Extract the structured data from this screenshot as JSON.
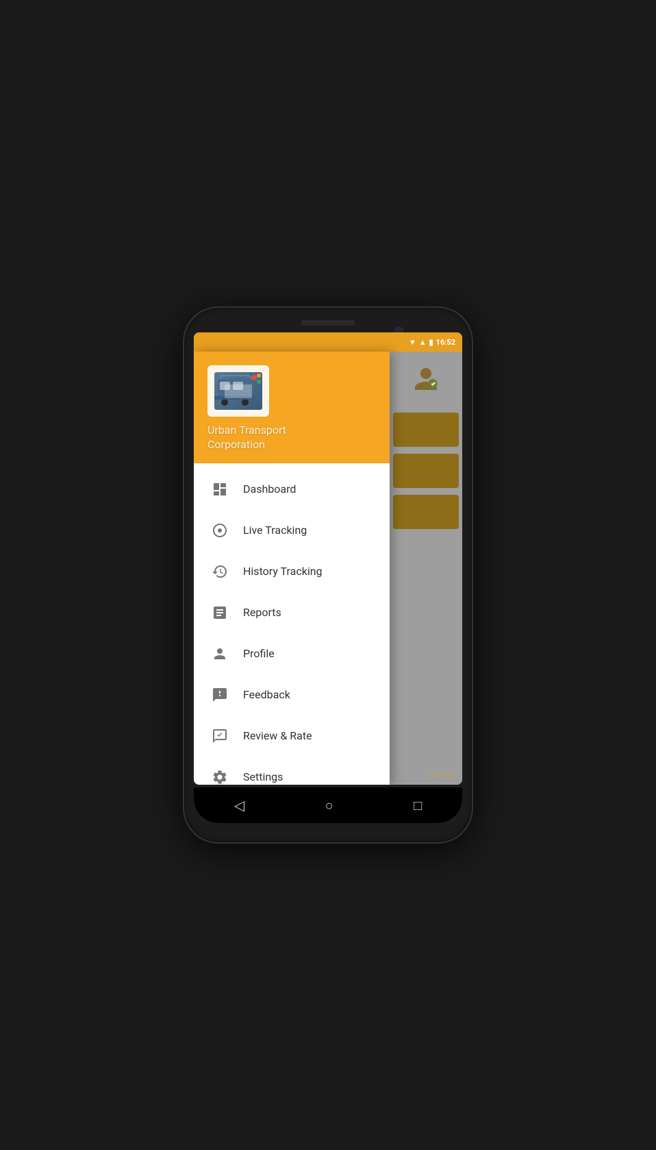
{
  "statusBar": {
    "time": "16:52",
    "wifiIcon": "▼",
    "signalIcon": "▲",
    "batteryIcon": "🔋"
  },
  "drawer": {
    "appName": "Urban Transport\nCorporation",
    "menuItems": [
      {
        "id": "dashboard",
        "label": "Dashboard",
        "icon": "grid"
      },
      {
        "id": "live-tracking",
        "label": "Live Tracking",
        "icon": "target"
      },
      {
        "id": "history-tracking",
        "label": "History Tracking",
        "icon": "history"
      },
      {
        "id": "reports",
        "label": "Reports",
        "icon": "clipboard"
      },
      {
        "id": "profile",
        "label": "Profile",
        "icon": "person"
      },
      {
        "id": "feedback",
        "label": "Feedback",
        "icon": "feedback"
      },
      {
        "id": "review-rate",
        "label": "Review & Rate",
        "icon": "rate"
      },
      {
        "id": "settings",
        "label": "Settings",
        "icon": "settings"
      }
    ]
  },
  "bgContent": {
    "footerText": "s reserved."
  },
  "navBar": {
    "backBtn": "◁",
    "homeBtn": "○",
    "recentBtn": "□"
  }
}
